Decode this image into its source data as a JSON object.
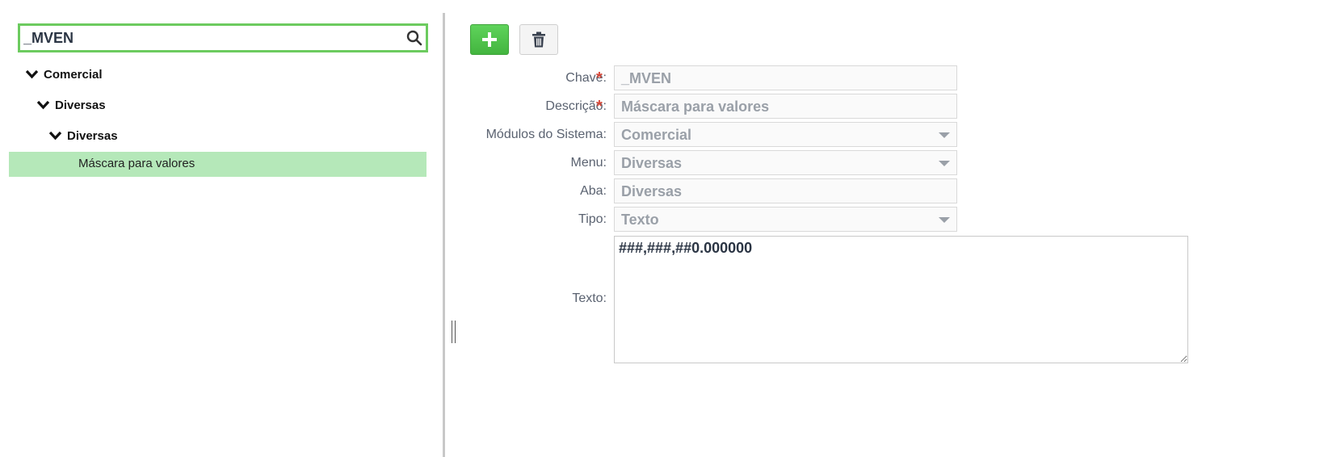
{
  "search": {
    "value": "_MVEN",
    "icon": "search-icon"
  },
  "tree": {
    "level1": {
      "label": "Comercial"
    },
    "level2": {
      "label": "Diversas"
    },
    "level3": {
      "label": "Diversas"
    },
    "selected_leaf": {
      "label": "Máscara para valores"
    }
  },
  "toolbar": {
    "add_icon": "plus-icon",
    "delete_icon": "trash-icon"
  },
  "form": {
    "chave": {
      "label": "Chave:",
      "value": "_MVEN",
      "required_mark": "*"
    },
    "descricao": {
      "label": "Descrição:",
      "value": "Máscara para valores",
      "required_mark": "*"
    },
    "modulos": {
      "label": "Módulos do Sistema:",
      "value": "Comercial"
    },
    "menu": {
      "label": "Menu:",
      "value": "Diversas"
    },
    "aba": {
      "label": "Aba:",
      "value": "Diversas"
    },
    "tipo": {
      "label": "Tipo:",
      "value": "Texto"
    },
    "texto": {
      "label": "Texto:",
      "value": "###,###,##0.000000"
    }
  },
  "colors": {
    "accent_green": "#6ccb5f",
    "selected_row": "#b5e8b9",
    "required": "#d7493a"
  }
}
